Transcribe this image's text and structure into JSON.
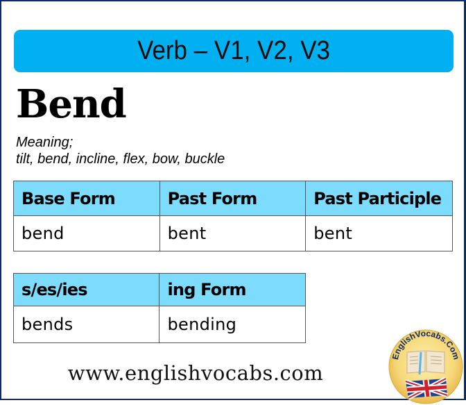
{
  "header": {
    "title": "Verb – V1, V2, V3"
  },
  "word": "Bend",
  "meaning": {
    "label": "Meaning;",
    "synonyms": "tilt, bend, incline, flex, bow, buckle"
  },
  "forms_table": {
    "headers": [
      "Base Form",
      "Past Form",
      "Past Participle"
    ],
    "values": [
      "bend",
      "bent",
      "bent"
    ]
  },
  "extra_table": {
    "headers": [
      "s/es/ies",
      "ing Form"
    ],
    "values": [
      "bends",
      "bending"
    ]
  },
  "footer": {
    "url": "www.englishvocabs.com"
  },
  "logo": {
    "text": "EnglishVocabs.Com",
    "icon": "book-and-uk-flag-icon"
  },
  "colors": {
    "title_bar": "#00b0f0",
    "table_header": "#7ddbfb",
    "frame_border": "#0b2a66"
  }
}
